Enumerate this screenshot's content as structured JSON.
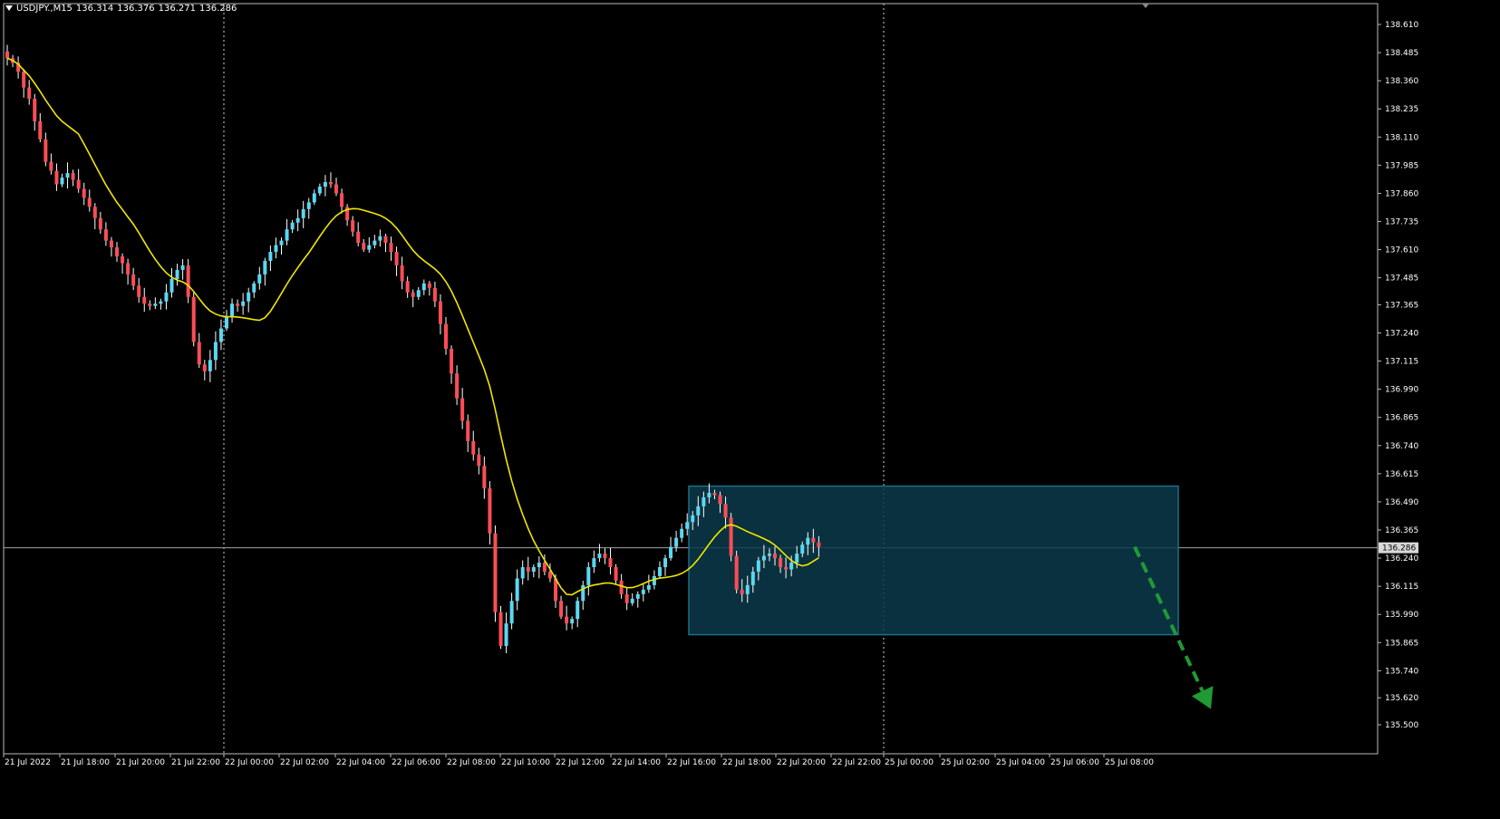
{
  "header": {
    "symbol": "USDJPY.,M15",
    "open": "136.314",
    "high": "136.376",
    "low": "136.271",
    "close": "136.286"
  },
  "colors": {
    "background": "#000000",
    "bull": "#5ad8f2",
    "bear": "#ff4d57",
    "ma": "#f0e600",
    "box_fill": "#0c3a4a",
    "box_stroke": "#1b6f86",
    "arrow": "#1f9a35",
    "axis": "#ffffff"
  },
  "chart_data": {
    "type": "candlestick",
    "symbol": "USDJPY.",
    "timeframe": "M15",
    "current_price": 136.286,
    "current_price_label": "136.286",
    "ylim": [
      135.5,
      138.65
    ],
    "y_ticks": [
      "138.610",
      "138.485",
      "138.360",
      "138.235",
      "138.110",
      "137.985",
      "137.860",
      "137.735",
      "137.610",
      "137.485",
      "137.365",
      "137.240",
      "137.115",
      "136.990",
      "136.865",
      "136.740",
      "136.615",
      "136.490",
      "136.365",
      "136.240",
      "136.115",
      "135.990",
      "135.865",
      "135.740",
      "135.620",
      "135.500"
    ],
    "x_ticks": [
      "21 Jul 2022",
      "21 Jul 18:00",
      "21 Jul 20:00",
      "21 Jul 22:00",
      "22 Jul 00:00",
      "22 Jul 02:00",
      "22 Jul 04:00",
      "22 Jul 06:00",
      "22 Jul 08:00",
      "22 Jul 10:00",
      "22 Jul 12:00",
      "22 Jul 14:00",
      "22 Jul 16:00",
      "22 Jul 18:00",
      "22 Jul 20:00",
      "22 Jul 22:00",
      "25 Jul 00:00",
      "25 Jul 02:00",
      "25 Jul 04:00",
      "25 Jul 06:00",
      "25 Jul 08:00"
    ],
    "day_separators": [
      "22 Jul 00:00",
      "25 Jul 00:00"
    ],
    "range_box": {
      "from_bar": 125,
      "to_bar": 214,
      "high": 136.56,
      "low": 135.9
    },
    "forecast_arrow": {
      "from_bar": 206,
      "from_price": 136.29,
      "to_bar": 222,
      "to_price": 135.57,
      "direction": "down"
    },
    "close_series": [
      138.46,
      138.44,
      138.4,
      138.33,
      138.28,
      138.18,
      138.1,
      138.0,
      137.96,
      137.9,
      137.93,
      137.95,
      137.92,
      137.88,
      137.84,
      137.8,
      137.75,
      137.7,
      137.65,
      137.62,
      137.58,
      137.55,
      137.5,
      137.45,
      137.4,
      137.37,
      137.36,
      137.37,
      137.38,
      137.42,
      137.48,
      137.52,
      137.54,
      137.4,
      137.2,
      137.1,
      137.07,
      137.12,
      137.2,
      137.26,
      137.31,
      137.37,
      137.36,
      137.38,
      137.42,
      137.46,
      137.5,
      137.56,
      137.6,
      137.63,
      137.65,
      137.7,
      137.73,
      137.75,
      137.79,
      137.82,
      137.86,
      137.89,
      137.91,
      137.9,
      137.86,
      137.8,
      137.74,
      137.69,
      137.64,
      137.61,
      137.63,
      137.65,
      137.67,
      137.64,
      137.6,
      137.54,
      137.47,
      137.42,
      137.4,
      137.43,
      137.46,
      137.44,
      137.38,
      137.28,
      137.17,
      137.06,
      136.95,
      136.85,
      136.76,
      136.7,
      136.65,
      136.55,
      136.35,
      136.0,
      135.85,
      135.95,
      136.05,
      136.15,
      136.2,
      136.18,
      136.2,
      136.22,
      136.18,
      136.15,
      136.05,
      135.98,
      135.95,
      135.97,
      136.05,
      136.12,
      136.2,
      136.24,
      136.26,
      136.24,
      136.2,
      136.14,
      136.08,
      136.04,
      136.06,
      136.08,
      136.1,
      136.12,
      136.16,
      136.2,
      136.24,
      136.29,
      136.33,
      136.37,
      136.4,
      136.43,
      136.47,
      136.51,
      136.53,
      136.52,
      136.48,
      136.42,
      136.25,
      136.1,
      136.08,
      136.12,
      136.18,
      136.23,
      136.25,
      136.26,
      136.24,
      136.2,
      136.19,
      136.22,
      136.26,
      136.3,
      136.33,
      136.31,
      136.29
    ],
    "moving_average": {
      "type": "MA",
      "color": "#f0e600"
    }
  }
}
